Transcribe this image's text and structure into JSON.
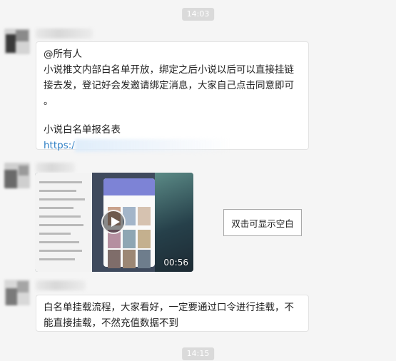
{
  "timestamps": [
    "14:03",
    "14:15"
  ],
  "messages": [
    {
      "lines": [
        "@所有人",
        "小说推文内部白名单开放，绑定之后小说以后可以直接挂链",
        "接去发，登记好会发邀请绑定消息，大家自己点击同意即可",
        "。",
        "",
        "小说白名单报名表",
        "https:/"
      ]
    },
    {
      "video_duration": "00:56",
      "overlay_hint": "双击可显示空白"
    },
    {
      "lines": [
        "白名单挂载流程，大家看好，一定要通过口令进行挂载，不",
        "能直接挂载，不然充值数据不到"
      ]
    }
  ],
  "colors": {
    "background": "#f5f5f5",
    "bubble": "#ffffff",
    "link": "#2d7ec4",
    "time_chip": "#dadada"
  }
}
